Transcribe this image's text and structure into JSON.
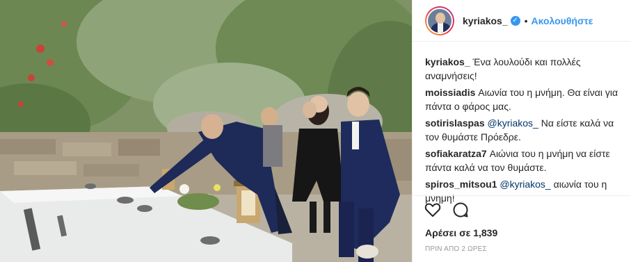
{
  "header": {
    "username": "kyriakos_",
    "verified_icon": "verified-badge-icon",
    "separator": "•",
    "follow_label": "Ακολουθήστε"
  },
  "comments": [
    {
      "user": "kyriakos_",
      "text": " Ένα λουλούδι και πολλές αναμνήσεις!"
    },
    {
      "user": "moissiadis",
      "text": " Αιωνία του η μνήμη. Θα είναι για πάντα ο φάρος μας."
    },
    {
      "user": "sotirislaspas",
      "mention": " @kyriakos_",
      "text": " Να είστε καλά να τον θυμάστε Πρόεδρε."
    },
    {
      "user": "sofiakaratza7",
      "text": " Αιώνια του η μνήμη να είστε πάντα καλά να τον θυμάστε."
    },
    {
      "user": "spiros_mitsou1",
      "mention": " @kyriakos_",
      "text": " αιωνία του η μνημη!"
    }
  ],
  "actions": {
    "like_icon": "heart-icon",
    "comment_icon": "comment-bubble-icon"
  },
  "likes": "Αρέσει σε 1,839",
  "timestamp": "ΠΡΙΝ ΑΠΟ 2 ΩΡΕΣ",
  "colors": {
    "accent": "#3897f0",
    "text": "#262626",
    "muted": "#999999",
    "mention": "#003569"
  }
}
